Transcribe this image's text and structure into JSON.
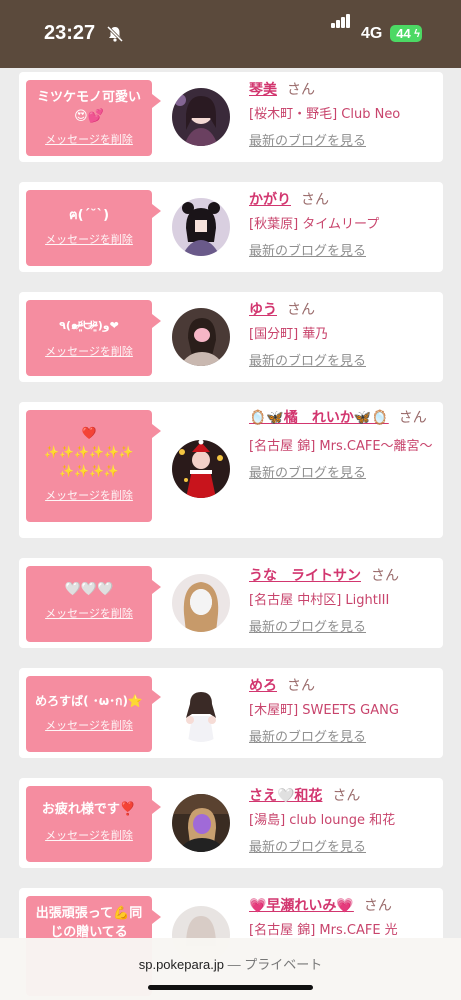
{
  "status_bar": {
    "time": "23:27",
    "network": "4G",
    "battery": "44",
    "icons": [
      "bell-slash-icon",
      "signal-icon",
      "battery-icon"
    ]
  },
  "colors": {
    "header_brown": "#5b4a3c",
    "bubble_pink": "#f58da0",
    "name_pink": "#d2366f"
  },
  "delete_label": "メッセージを削除",
  "san_label": "さん",
  "blog_label": "最新のブログを見る",
  "cards": [
    {
      "message": "ミツケモノ可愛い\n😍💕",
      "name": "琴美",
      "shop": "[桜木町・野毛] Club Neo"
    },
    {
      "message": "ฅ(ˊ˘ˋ)",
      "name": "かがり",
      "shop": "[秋葉原] タイムリープ"
    },
    {
      "message": "٩(๑ᵒ̴̶̷͈᷄ᗨᵒ̴̶̷͈᷅)و❤",
      "name": "ゆう",
      "shop": "[国分町] 華乃"
    },
    {
      "message": "❤️\n✨✨✨✨✨✨\n✨✨✨✨",
      "name": "🪞🦋橘　れいか🦋🪞",
      "shop": "[名古屋 錦] Mrs.CAFE〜離宮〜"
    },
    {
      "message": "🤍🤍🤍",
      "name": "うな　ライトサン",
      "shop": "[名古屋 中村区] LightIII"
    },
    {
      "message": "めろすば( ･ω･ก)⭐",
      "name": "めろ",
      "shop": "[木屋町] SWEETS GANG"
    },
    {
      "message": "お疲れ様です❣️",
      "name": "さえ🤍和花",
      "shop": "[湯島] club lounge 和花"
    },
    {
      "message": "出張頑張って💪同\nじの贈いてる",
      "name": "💗早瀬れいみ💗",
      "shop": "[名古屋 錦] Mrs.CAFE 光"
    }
  ],
  "browser": {
    "url": "sp.pokepara.jp",
    "separator": " — ",
    "mode": "プライベート"
  }
}
